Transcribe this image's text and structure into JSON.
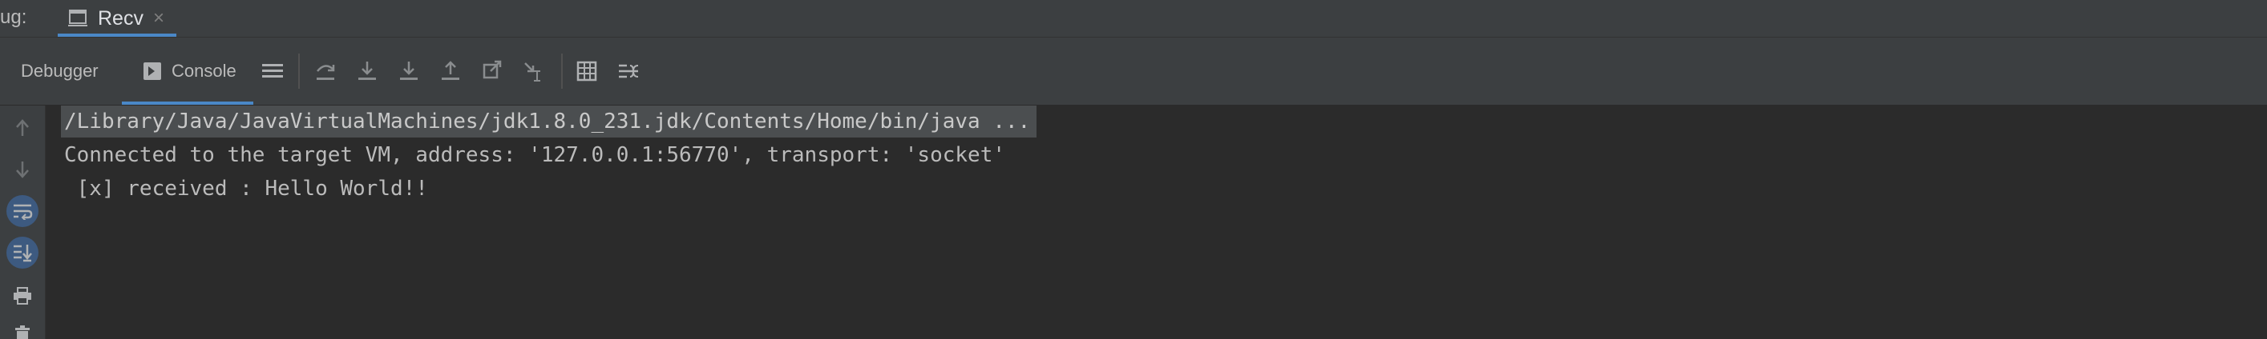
{
  "tabbar": {
    "label": "ug:",
    "run_tab": {
      "title": "Recv",
      "icon": "run-window-icon",
      "close": "×"
    }
  },
  "toolbar": {
    "debugger_label": "Debugger",
    "console_label": "Console",
    "icons": [
      "layout-list-icon",
      "step-over-icon",
      "step-into-icon",
      "force-step-into-icon",
      "step-out-icon",
      "drop-frame-icon",
      "run-to-cursor-icon",
      "evaluate-expression-icon",
      "trace-current-stream-icon"
    ]
  },
  "gutter": {
    "icons": [
      "up-arrow-icon",
      "down-arrow-icon",
      "soft-wrap-icon",
      "scroll-to-end-icon",
      "print-icon",
      "trash-icon"
    ]
  },
  "console": {
    "lines": [
      "/Library/Java/JavaVirtualMachines/jdk1.8.0_231.jdk/Contents/Home/bin/java ...",
      "Connected to the target VM, address: '127.0.0.1:56770', transport: 'socket'",
      " [x] received : Hello World!!"
    ]
  },
  "colors": {
    "background": "#2b2b2b",
    "panel": "#3c3f41",
    "accent": "#4a88c7",
    "text": "#bbbbbb"
  }
}
